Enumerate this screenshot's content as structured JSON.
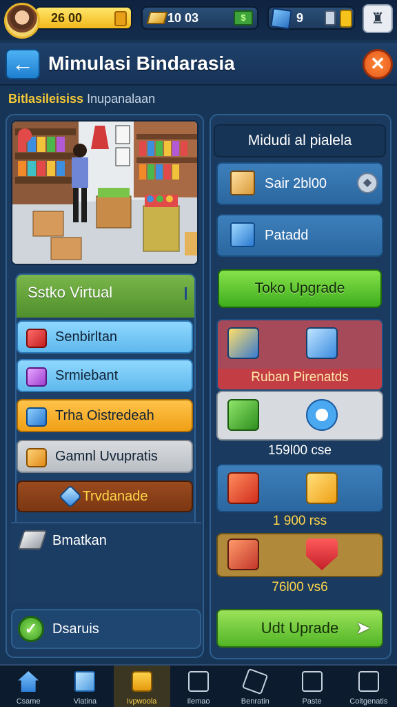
{
  "topbar": {
    "gold_value": "26 00",
    "cash_value": "10 03",
    "gems_value": "9"
  },
  "header": {
    "title": "Mimulasi Bindarasia",
    "back_icon": "arrow-left-icon",
    "close_icon": "close-icon"
  },
  "subtitle": {
    "highlight": "Bitlasileisiss",
    "text": "Inupanalaan"
  },
  "left_panel": {
    "card_title": "Sstko Virtual",
    "buttons": [
      {
        "label": "Senbirltan",
        "icon": "red-gift-icon"
      },
      {
        "label": "Srmiebant",
        "icon": "purple-gift-icon"
      },
      {
        "label": "Trha Oistredeah",
        "icon": "blue-gift-icon"
      },
      {
        "label": "Gamnl Uvupratis",
        "icon": "orange-cube-icon"
      },
      {
        "label": "Trvdanade",
        "icon": "diamond-icon"
      }
    ],
    "row1_label": "Bmatkan",
    "row2_label": "Dsaruis"
  },
  "right_panel": {
    "header": "Midudi al pialela",
    "row1_label": "Sair 2bl00",
    "row2_label": "Patadd",
    "upgrade_button": "Toko Upgrade",
    "card1_label": "Ruban Pirenatds",
    "card2_price": "159l00 cse",
    "card3_price": "1 900 rss",
    "card4_price": "76l00 vs6",
    "udt_button": "Udt Uprade"
  },
  "nav": {
    "items": [
      {
        "label": "Csame",
        "icon": "home-icon"
      },
      {
        "label": "Viatina",
        "icon": "cube-icon"
      },
      {
        "label": "Ivpwoola",
        "icon": "gift-icon"
      },
      {
        "label": "Ilemao",
        "icon": "dice-icon"
      },
      {
        "label": "Benratin",
        "icon": "puzzle-icon"
      },
      {
        "label": "Paste",
        "icon": "exit-icon"
      },
      {
        "label": "Coltgenatis",
        "icon": "window-icon"
      }
    ]
  },
  "colors": {
    "accent_blue": "#2b67a0",
    "gold": "#f2b81b",
    "green": "#3fae1e"
  }
}
